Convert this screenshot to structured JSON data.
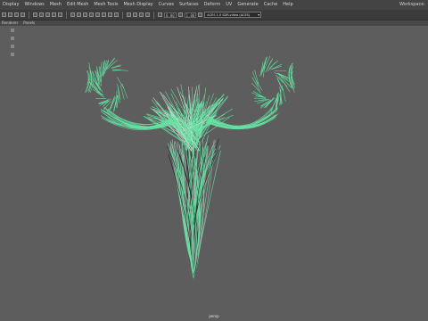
{
  "menu": {
    "items": [
      "Display",
      "Windows",
      "Mesh",
      "Edit Mesh",
      "Mesh Tools",
      "Mesh Display",
      "Curves",
      "Surfaces",
      "Deform",
      "UV",
      "Generate",
      "Cache",
      "Help"
    ],
    "workspace_label": "Workspace:"
  },
  "toolbar": {
    "field_1": "0.00",
    "field_2": "1.00",
    "color_space": "ACES 1.0 SDR-video (ACES)"
  },
  "panel": {
    "items": [
      "Renderer",
      "Panels"
    ]
  },
  "viewport": {
    "camera_label": "persp",
    "hair_color": "#66e3a4"
  }
}
